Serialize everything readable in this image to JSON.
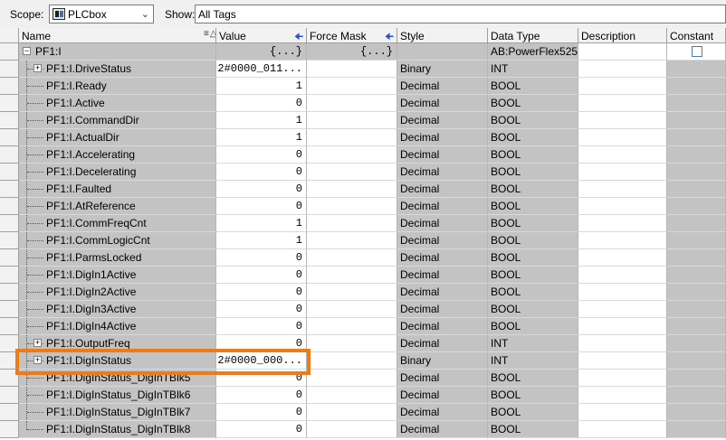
{
  "toolbar": {
    "scope_label": "Scope:",
    "scope_value": "PLCbox",
    "show_label": "Show:",
    "show_value": "All Tags"
  },
  "columns": [
    "Name",
    "Value",
    "Force Mask",
    "Style",
    "Data Type",
    "Description",
    "Constant"
  ],
  "rows": [
    {
      "name": "PF1:I",
      "value": "{...}",
      "force": "{...}",
      "style": "",
      "type": "AB:PowerFlex525...",
      "expander": "minus",
      "level": 0
    },
    {
      "name": "PF1:I.DriveStatus",
      "value": "2#0000_011...",
      "force": "",
      "style": "Binary",
      "type": "INT",
      "expander": "plus",
      "level": 1
    },
    {
      "name": "PF1:I.Ready",
      "value": "1",
      "force": "",
      "style": "Decimal",
      "type": "BOOL",
      "expander": "",
      "level": 1
    },
    {
      "name": "PF1:I.Active",
      "value": "0",
      "force": "",
      "style": "Decimal",
      "type": "BOOL",
      "expander": "",
      "level": 1
    },
    {
      "name": "PF1:I.CommandDir",
      "value": "1",
      "force": "",
      "style": "Decimal",
      "type": "BOOL",
      "expander": "",
      "level": 1
    },
    {
      "name": "PF1:I.ActualDir",
      "value": "1",
      "force": "",
      "style": "Decimal",
      "type": "BOOL",
      "expander": "",
      "level": 1
    },
    {
      "name": "PF1:I.Accelerating",
      "value": "0",
      "force": "",
      "style": "Decimal",
      "type": "BOOL",
      "expander": "",
      "level": 1
    },
    {
      "name": "PF1:I.Decelerating",
      "value": "0",
      "force": "",
      "style": "Decimal",
      "type": "BOOL",
      "expander": "",
      "level": 1
    },
    {
      "name": "PF1:I.Faulted",
      "value": "0",
      "force": "",
      "style": "Decimal",
      "type": "BOOL",
      "expander": "",
      "level": 1
    },
    {
      "name": "PF1:I.AtReference",
      "value": "0",
      "force": "",
      "style": "Decimal",
      "type": "BOOL",
      "expander": "",
      "level": 1
    },
    {
      "name": "PF1:I.CommFreqCnt",
      "value": "1",
      "force": "",
      "style": "Decimal",
      "type": "BOOL",
      "expander": "",
      "level": 1
    },
    {
      "name": "PF1:I.CommLogicCnt",
      "value": "1",
      "force": "",
      "style": "Decimal",
      "type": "BOOL",
      "expander": "",
      "level": 1
    },
    {
      "name": "PF1:I.ParmsLocked",
      "value": "0",
      "force": "",
      "style": "Decimal",
      "type": "BOOL",
      "expander": "",
      "level": 1
    },
    {
      "name": "PF1:I.DigIn1Active",
      "value": "0",
      "force": "",
      "style": "Decimal",
      "type": "BOOL",
      "expander": "",
      "level": 1
    },
    {
      "name": "PF1:I.DigIn2Active",
      "value": "0",
      "force": "",
      "style": "Decimal",
      "type": "BOOL",
      "expander": "",
      "level": 1
    },
    {
      "name": "PF1:I.DigIn3Active",
      "value": "0",
      "force": "",
      "style": "Decimal",
      "type": "BOOL",
      "expander": "",
      "level": 1
    },
    {
      "name": "PF1:I.DigIn4Active",
      "value": "0",
      "force": "",
      "style": "Decimal",
      "type": "BOOL",
      "expander": "",
      "level": 1
    },
    {
      "name": "PF1:I.OutputFreq",
      "value": "0",
      "force": "",
      "style": "Decimal",
      "type": "INT",
      "expander": "plus",
      "level": 1
    },
    {
      "name": "PF1:I.DigInStatus",
      "value": "2#0000_000...",
      "force": "",
      "style": "Binary",
      "type": "INT",
      "expander": "plus",
      "level": 1
    },
    {
      "name": "PF1:I.DigInStatus_DigInTBlk5",
      "value": "0",
      "force": "",
      "style": "Decimal",
      "type": "BOOL",
      "expander": "",
      "level": 1
    },
    {
      "name": "PF1:I.DigInStatus_DigInTBlk6",
      "value": "0",
      "force": "",
      "style": "Decimal",
      "type": "BOOL",
      "expander": "",
      "level": 1
    },
    {
      "name": "PF1:I.DigInStatus_DigInTBlk7",
      "value": "0",
      "force": "",
      "style": "Decimal",
      "type": "BOOL",
      "expander": "",
      "level": 1
    },
    {
      "name": "PF1:I.DigInStatus_DigInTBlk8",
      "value": "0",
      "force": "",
      "style": "Decimal",
      "type": "BOOL",
      "expander": "",
      "level": 1
    }
  ],
  "icons": {
    "scope": "controller-icon",
    "dropdown": "chevron-down-icon",
    "sort": "sort-icon",
    "arrow": "arrow-left-icon",
    "checkbox": "checkbox-icon"
  },
  "colors": {
    "readonly_cell": "#c3c3c3",
    "highlight": "#f07a15",
    "header_arrow": "#2c4fd0"
  }
}
